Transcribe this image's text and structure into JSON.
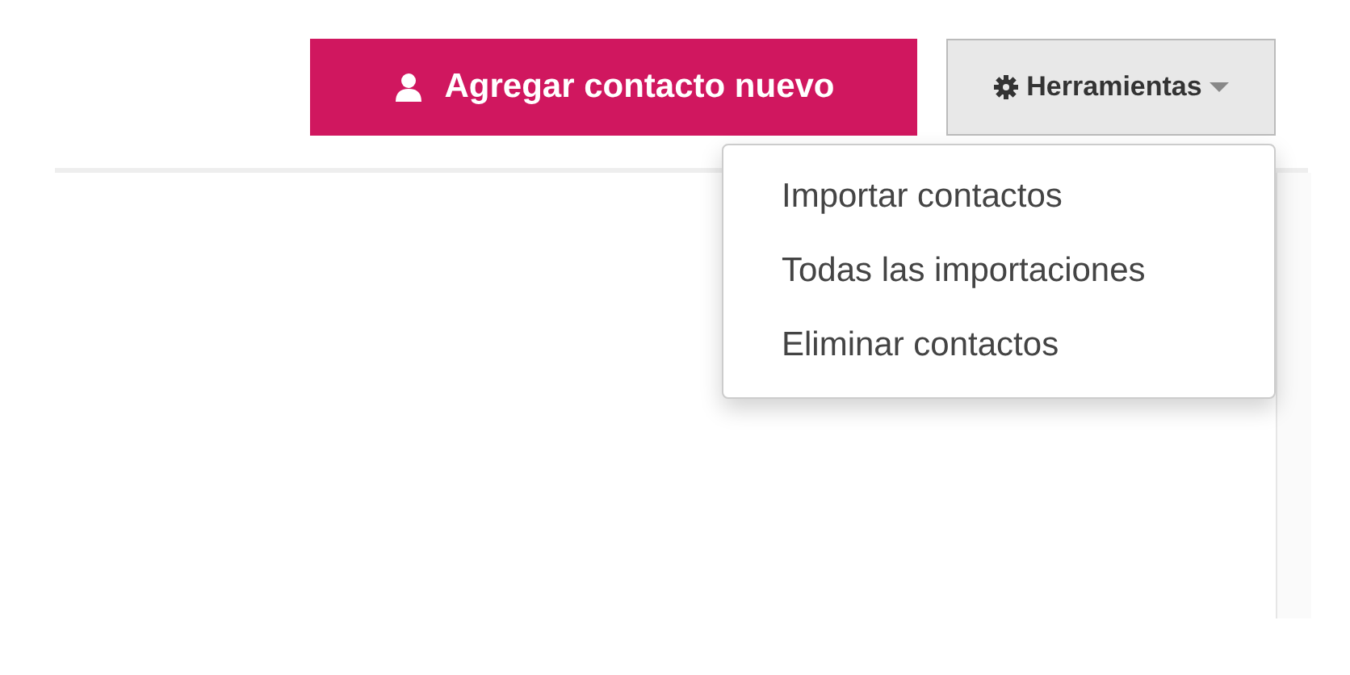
{
  "add_button": {
    "label": "Agregar contacto nuevo"
  },
  "tools_menu": {
    "label": "Herramientas",
    "expanded": true,
    "items": [
      {
        "label": "Importar contactos"
      },
      {
        "label": "Todas las importaciones"
      },
      {
        "label": "Eliminar contactos"
      }
    ]
  }
}
